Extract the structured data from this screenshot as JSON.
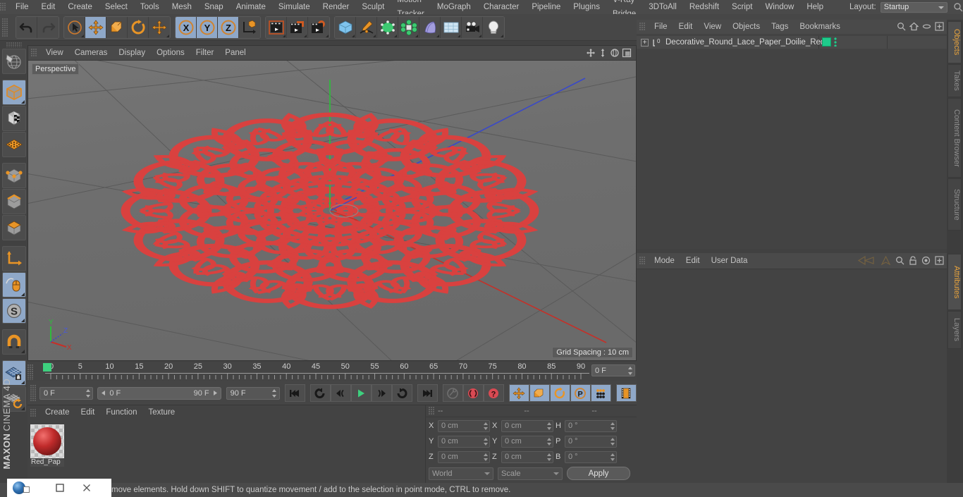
{
  "app": {
    "brand_top": "MAXON",
    "brand_bottom": "CINEMA 4D"
  },
  "menubar": {
    "items": [
      {
        "label": "File"
      },
      {
        "label": "Edit"
      },
      {
        "label": "Create"
      },
      {
        "label": "Select"
      },
      {
        "label": "Tools"
      },
      {
        "label": "Mesh"
      },
      {
        "label": "Snap"
      },
      {
        "label": "Animate"
      },
      {
        "label": "Simulate"
      },
      {
        "label": "Render"
      },
      {
        "label": "Sculpt"
      },
      {
        "label": "Motion Tracker"
      },
      {
        "label": "MoGraph"
      },
      {
        "label": "Character"
      },
      {
        "label": "Pipeline"
      },
      {
        "label": "Plugins"
      },
      {
        "label": "V-Ray Bridge"
      },
      {
        "label": "3DToAll"
      },
      {
        "label": "Redshift"
      },
      {
        "label": "Script"
      },
      {
        "label": "Window"
      },
      {
        "label": "Help"
      }
    ],
    "layout_label": "Layout:",
    "layout_value": "Startup",
    "search_icon": "search-icon"
  },
  "toolbar": {
    "groups": [
      {
        "name": "undo-redo",
        "buttons": [
          {
            "name": "undo-button",
            "icon": "undo-arrow-icon",
            "active": false
          },
          {
            "name": "redo-button",
            "icon": "redo-arrow-icon",
            "active": false,
            "disabled": true
          }
        ]
      },
      {
        "name": "transform-tools",
        "buttons": [
          {
            "name": "live-selection-tool",
            "icon": "cursor-circle-icon",
            "active": false
          },
          {
            "name": "move-tool",
            "icon": "move-arrows-icon",
            "active": true
          },
          {
            "name": "scale-tool",
            "icon": "scale-box-icon",
            "active": false
          },
          {
            "name": "rotate-tool",
            "icon": "rotate-arc-icon",
            "active": false
          },
          {
            "name": "transform-extra-tool",
            "icon": "move-arrows-icon",
            "active": false
          }
        ]
      },
      {
        "name": "axis-locks",
        "buttons": [
          {
            "name": "lock-x-axis",
            "icon": "x-axis-icon",
            "active": true
          },
          {
            "name": "lock-y-axis",
            "icon": "y-axis-icon",
            "active": true
          },
          {
            "name": "lock-z-axis",
            "icon": "z-axis-icon",
            "active": true
          },
          {
            "name": "world-object-coordinate-toggle",
            "icon": "world-axis-cube-icon",
            "active": false
          }
        ]
      },
      {
        "name": "render-group",
        "buttons": [
          {
            "name": "render-view-button",
            "icon": "clapper-icon",
            "active": false
          },
          {
            "name": "render-to-picture-viewer-button",
            "icon": "clapper-picture-icon",
            "active": false
          },
          {
            "name": "render-settings-button",
            "icon": "clapper-gear-icon",
            "active": false
          }
        ]
      },
      {
        "name": "create-group",
        "buttons": [
          {
            "name": "add-cube-primitive-button",
            "icon": "blue-cube-icon",
            "active": false
          },
          {
            "name": "add-spline-button",
            "icon": "pen-spline-icon",
            "active": false
          },
          {
            "name": "add-generator-button",
            "icon": "green-cube-icon",
            "active": false
          },
          {
            "name": "add-array-button",
            "icon": "green-cluster-icon",
            "active": false
          },
          {
            "name": "add-deformer-button",
            "icon": "bend-deformer-icon",
            "active": false
          },
          {
            "name": "add-floor-environment-button",
            "icon": "floor-grid-icon",
            "active": false
          },
          {
            "name": "add-camera-button",
            "icon": "camera-icon",
            "active": false
          },
          {
            "name": "add-light-button",
            "icon": "light-bulb-icon",
            "active": false
          }
        ]
      }
    ]
  },
  "left_toolbar": {
    "buttons": [
      {
        "name": "render-region-tool",
        "icon": "globe-sphere-icon",
        "active": false
      },
      {
        "name": "object-mode-tool",
        "icon": "grey-cube-icon",
        "active": true
      },
      {
        "name": "texture-mode-tool",
        "icon": "checker-cube-icon",
        "active": false
      },
      {
        "name": "deformed-editing-tool",
        "icon": "orange-lattice-icon",
        "active": false
      },
      {
        "name": "points-mode-tool",
        "icon": "cube-points-icon",
        "active": false
      },
      {
        "name": "edges-mode-tool",
        "icon": "cube-edges-icon",
        "active": false
      },
      {
        "name": "polygons-mode-tool",
        "icon": "cube-polygon-icon",
        "active": false
      },
      {
        "name": "workplane-tool",
        "icon": "orange-axis-icon",
        "active": false
      },
      {
        "name": "enable-snapping-tool",
        "icon": "mouse-snap-icon",
        "active": true
      },
      {
        "name": "scale-snap-tool",
        "icon": "s-circle-icon",
        "active": true
      },
      {
        "name": "magnet-tool",
        "icon": "magnet-icon",
        "active": false
      },
      {
        "name": "lock-workplane-tool",
        "icon": "grid-lock-icon",
        "active": true
      },
      {
        "name": "planar-workplane-tool",
        "icon": "grid-rotate-icon",
        "active": false
      }
    ]
  },
  "viewport": {
    "menu": [
      {
        "label": "View"
      },
      {
        "label": "Cameras"
      },
      {
        "label": "Display"
      },
      {
        "label": "Options"
      },
      {
        "label": "Filter"
      },
      {
        "label": "Panel"
      }
    ],
    "view_label": "Perspective",
    "grid_spacing": "Grid Spacing : 10 cm",
    "axis_labels": {
      "x": "X",
      "y": "Y",
      "z": "Z"
    },
    "corner_icons": [
      {
        "name": "viewport-pan-icon"
      },
      {
        "name": "viewport-dolly-icon"
      },
      {
        "name": "viewport-rotate-icon"
      },
      {
        "name": "viewport-maximize-icon"
      }
    ],
    "model_color": "#d9413f",
    "background_color": "#6f6f6f"
  },
  "timeline": {
    "ticks": [
      {
        "label": "0",
        "value": 0
      },
      {
        "label": "5",
        "value": 5
      },
      {
        "label": "10",
        "value": 10
      },
      {
        "label": "15",
        "value": 15
      },
      {
        "label": "20",
        "value": 20
      },
      {
        "label": "25",
        "value": 25
      },
      {
        "label": "30",
        "value": 30
      },
      {
        "label": "35",
        "value": 35
      },
      {
        "label": "40",
        "value": 40
      },
      {
        "label": "45",
        "value": 45
      },
      {
        "label": "50",
        "value": 50
      },
      {
        "label": "55",
        "value": 55
      },
      {
        "label": "60",
        "value": 60
      },
      {
        "label": "65",
        "value": 65
      },
      {
        "label": "70",
        "value": 70
      },
      {
        "label": "75",
        "value": 75
      },
      {
        "label": "80",
        "value": 80
      },
      {
        "label": "85",
        "value": 85
      },
      {
        "label": "90",
        "value": 90
      }
    ],
    "range_min": 0,
    "range_max": 90,
    "playhead_frame": 0,
    "current_frame_field": "0 F",
    "playhead_color": "#3dd07e"
  },
  "transport": {
    "current_frame": "0 F",
    "range_start": "0 F",
    "range_end": "90 F",
    "end_frame": "90 F",
    "buttons": [
      {
        "name": "go-to-start-button",
        "icon": "skip-start-icon",
        "active": false
      },
      {
        "name": "play-backwards-button",
        "icon": "rewind-loop-icon",
        "active": false
      },
      {
        "name": "previous-frame-button",
        "icon": "step-back-icon",
        "active": false
      },
      {
        "name": "play-forward-button",
        "icon": "play-icon",
        "active": false
      },
      {
        "name": "next-frame-button",
        "icon": "step-forward-icon",
        "active": false
      },
      {
        "name": "play-loop-button",
        "icon": "loop-icon",
        "active": false
      },
      {
        "name": "go-to-end-button",
        "icon": "skip-end-icon",
        "active": false
      },
      {
        "name": "record-active-objects-button",
        "icon": "key-icon",
        "active": false
      },
      {
        "name": "autokeying-button",
        "icon": "red-circle-arrows-icon",
        "active": false
      },
      {
        "name": "keyframe-selection-button",
        "icon": "red-question-icon",
        "active": false
      },
      {
        "name": "position-key-button",
        "icon": "position-move-icon",
        "active": true
      },
      {
        "name": "scale-key-button",
        "icon": "scale-key-icon",
        "active": true
      },
      {
        "name": "rotation-key-button",
        "icon": "rotation-key-icon",
        "active": true
      },
      {
        "name": "parameter-key-button",
        "icon": "p-circle-icon",
        "active": true
      },
      {
        "name": "point-level-animation-button",
        "icon": "pla-dots-icon",
        "active": true
      },
      {
        "name": "timeline-filmstrip-button",
        "icon": "filmstrip-icon",
        "active": true
      }
    ]
  },
  "material_manager": {
    "menu": [
      {
        "label": "Create"
      },
      {
        "label": "Edit"
      },
      {
        "label": "Function"
      },
      {
        "label": "Texture"
      }
    ],
    "materials": [
      {
        "name": "Red_Pap",
        "color": "#c02b2b",
        "selected": true
      }
    ]
  },
  "coordinates": {
    "header_cols": [
      "--",
      "--",
      "--"
    ],
    "rows": [
      {
        "pos_label": "X",
        "pos_value": "0 cm",
        "size_label": "X",
        "size_value": "0 cm",
        "rot_label": "H",
        "rot_value": "0 °"
      },
      {
        "pos_label": "Y",
        "pos_value": "0 cm",
        "size_label": "Y",
        "size_value": "0 cm",
        "rot_label": "P",
        "rot_value": "0 °"
      },
      {
        "pos_label": "Z",
        "pos_value": "0 cm",
        "size_label": "Z",
        "size_value": "0 cm",
        "rot_label": "B",
        "rot_value": "0 °"
      }
    ],
    "coord_system": "World",
    "size_mode": "Scale",
    "apply_label": "Apply"
  },
  "object_manager": {
    "menu": [
      {
        "label": "File"
      },
      {
        "label": "Edit"
      },
      {
        "label": "View"
      },
      {
        "label": "Objects"
      },
      {
        "label": "Tags"
      },
      {
        "label": "Bookmarks"
      }
    ],
    "header_icons": [
      {
        "name": "search-icon"
      },
      {
        "name": "home-icon"
      },
      {
        "name": "ellipse-icon"
      },
      {
        "name": "new-layer-icon"
      }
    ],
    "objects": [
      {
        "name": "Decorative_Round_Lace_Paper_Doilie_Red",
        "type_icon": "polygon-object-icon",
        "expandable": true,
        "tag_color": "#1ecb8b"
      }
    ]
  },
  "attributes_manager": {
    "menu": [
      {
        "label": "Mode"
      },
      {
        "label": "Edit"
      },
      {
        "label": "User Data"
      }
    ],
    "header_icons": [
      {
        "name": "navigate-back-icon"
      },
      {
        "name": "navigate-up-icon"
      },
      {
        "name": "search-icon"
      },
      {
        "name": "lock-icon"
      },
      {
        "name": "target-icon"
      },
      {
        "name": "new-tab-icon"
      }
    ],
    "content": ""
  },
  "right_tabs": [
    {
      "label": "Objects",
      "active": true
    },
    {
      "label": "Takes",
      "active": false
    },
    {
      "label": "Content Browser",
      "active": false
    },
    {
      "label": "Structure",
      "active": false
    }
  ],
  "right_tabs_lower": [
    {
      "label": "Attributes",
      "active": true
    },
    {
      "label": "Layers",
      "active": false
    }
  ],
  "statusbar": {
    "message": "move elements. Hold down SHIFT to quantize movement / add to the selection in point mode, CTRL to remove."
  },
  "taskbar": {
    "buttons": [
      {
        "name": "app-icon",
        "label": ""
      },
      {
        "name": "minimize-window-button",
        "label": "–"
      },
      {
        "name": "maximize-window-button",
        "label": "☐"
      },
      {
        "name": "close-window-button",
        "label": "✕"
      }
    ]
  }
}
